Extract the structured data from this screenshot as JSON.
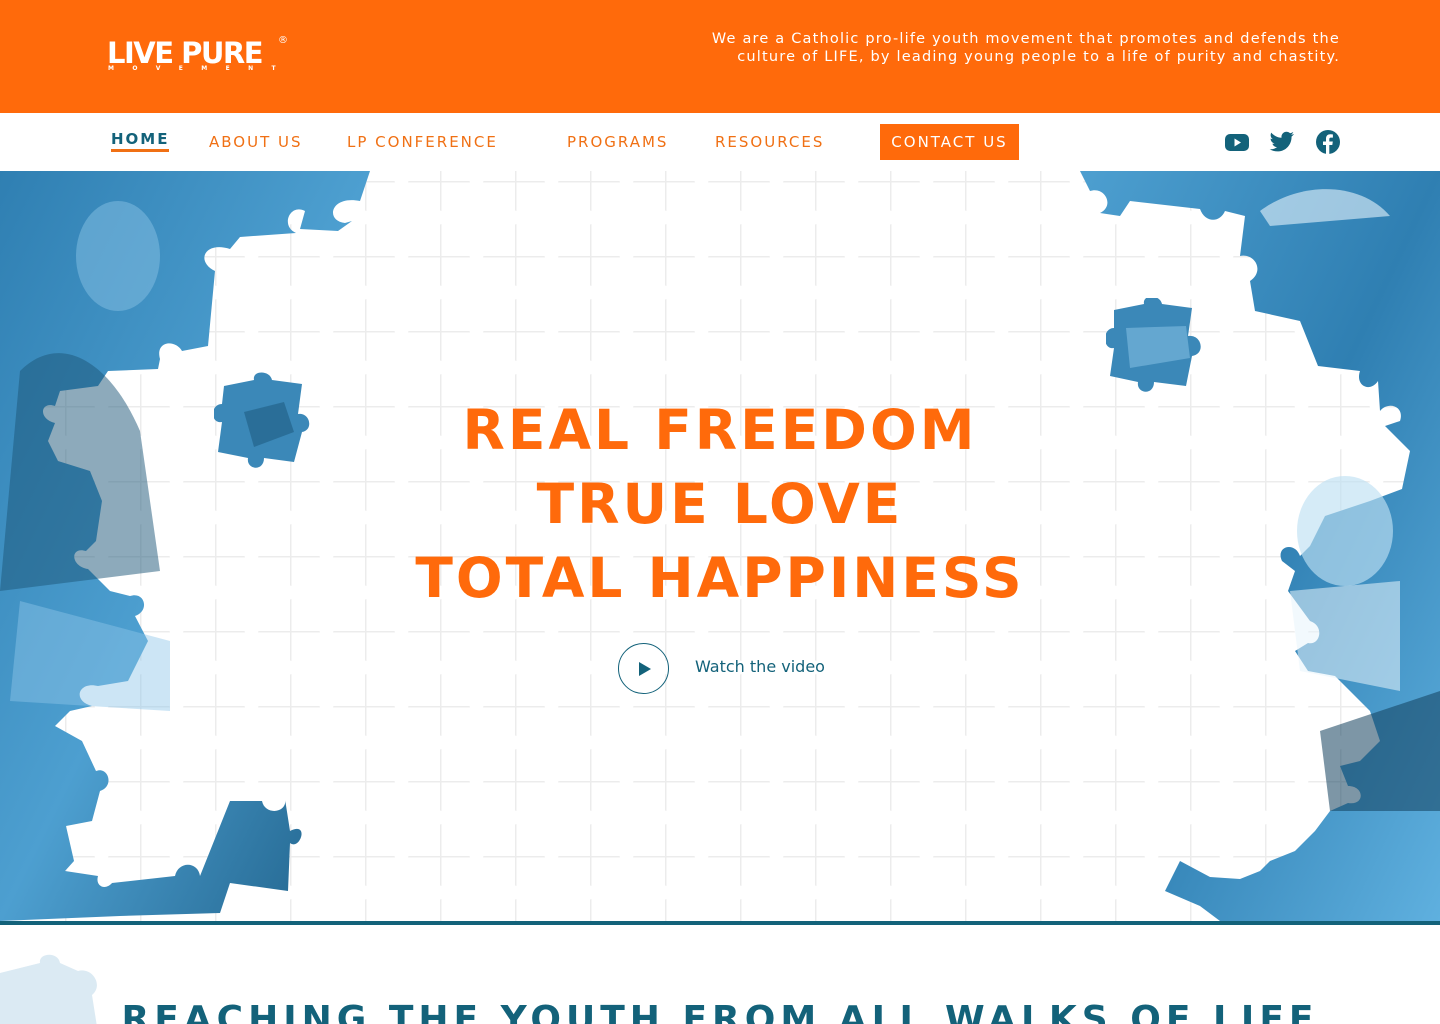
{
  "header": {
    "logo_main": "LIVE PURE",
    "logo_reg": "®",
    "logo_sub": "MOVEMENT",
    "tagline": "We are a Catholic pro-life youth movement that promotes and defends the culture of LIFE, by leading young people to a life of purity and chastity."
  },
  "nav": {
    "home": "HOME",
    "about": "ABOUT US",
    "conference": "LP CONFERENCE",
    "programs": "PROGRAMS",
    "resources": "RESOURCES",
    "contact": "CONTACT US"
  },
  "social": {
    "icons": [
      "youtube-icon",
      "twitter-icon",
      "facebook-icon"
    ]
  },
  "hero": {
    "line1": "REAL FREEDOM",
    "line2": "TRUE LOVE",
    "line3": "TOTAL HAPPINESS",
    "video_label": "Watch the video"
  },
  "section": {
    "title": "REACHING THE YOUTH FROM  ALL WALKS OF LIFE"
  },
  "colors": {
    "brand_orange": "#ff6a0b",
    "brand_teal": "#13627a",
    "photo_blue": "#3f8fbf"
  }
}
